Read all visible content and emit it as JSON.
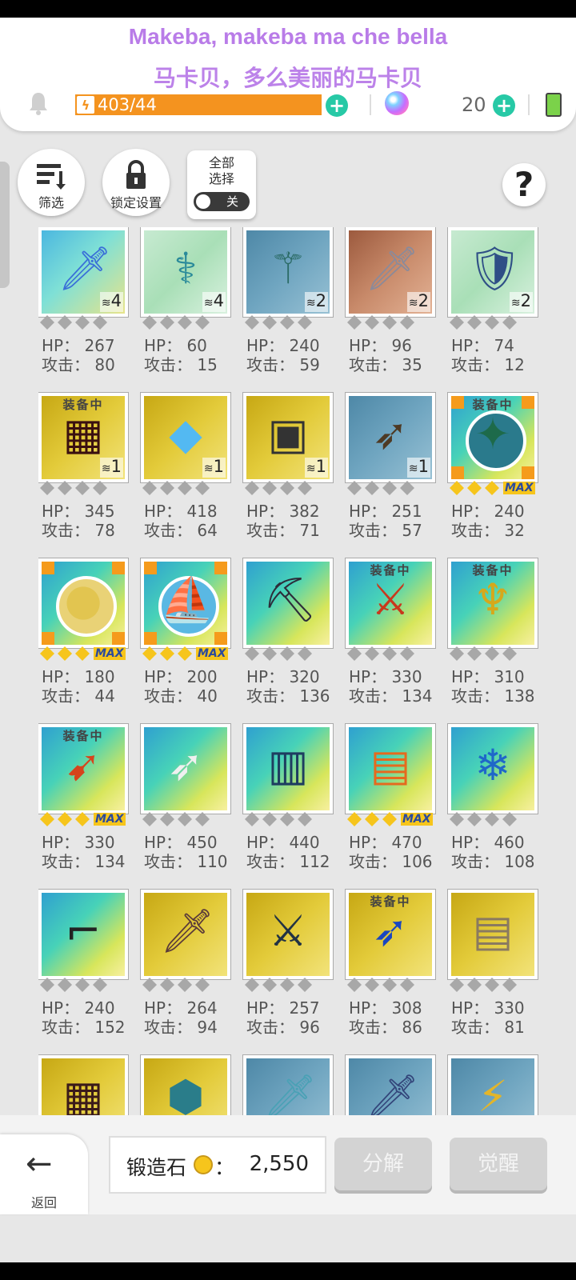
{
  "lyrics": {
    "line1": "Makeba, makeba ma che bella",
    "line2": "马卡贝，多么美丽的马卡贝"
  },
  "resources": {
    "energy": "403/44",
    "gems": "20",
    "bolt_icon": "lightning-icon"
  },
  "actions": {
    "filter_label": "筛选",
    "lock_label": "锁定设置",
    "select_all_label": "全部\n选择",
    "select_all_line1": "全部",
    "select_all_line2": "选择",
    "toggle_state": "关",
    "help_symbol": "?"
  },
  "equipped_label": "装备中",
  "items": [
    {
      "icon": "crystal-sword-icon",
      "bg": "blue",
      "qty": "4",
      "stars": 4,
      "gold": 0,
      "max": false,
      "equipped": false,
      "hp": "HP： 267",
      "atk": "攻击： 80"
    },
    {
      "icon": "staff-icon",
      "bg": "green",
      "qty": "4",
      "stars": 4,
      "gold": 0,
      "max": false,
      "equipped": false,
      "hp": "HP： 60",
      "atk": "攻击： 15"
    },
    {
      "icon": "scythe-staff-icon",
      "bg": "teal",
      "qty": "2",
      "stars": 4,
      "gold": 0,
      "max": false,
      "equipped": false,
      "hp": "HP： 240",
      "atk": "攻击： 59"
    },
    {
      "icon": "broadsword-icon",
      "bg": "copper",
      "qty": "2",
      "stars": 4,
      "gold": 0,
      "max": false,
      "equipped": false,
      "hp": "HP： 96",
      "atk": "攻击： 35"
    },
    {
      "icon": "shield-icon",
      "bg": "green",
      "qty": "2",
      "stars": 4,
      "gold": 0,
      "max": false,
      "equipped": false,
      "hp": "HP： 74",
      "atk": "攻击： 12"
    },
    {
      "icon": "dark-tome-icon",
      "bg": "gold",
      "qty": "1",
      "stars": 4,
      "gold": 0,
      "max": false,
      "equipped": true,
      "hp": "HP： 345",
      "atk": "攻击： 78"
    },
    {
      "icon": "diamond-icon",
      "bg": "gold",
      "qty": "1",
      "stars": 4,
      "gold": 0,
      "max": false,
      "equipped": false,
      "hp": "HP： 418",
      "atk": "攻击： 64"
    },
    {
      "icon": "device-icon",
      "bg": "gold",
      "qty": "1",
      "stars": 4,
      "gold": 0,
      "max": false,
      "equipped": false,
      "hp": "HP： 382",
      "atk": "攻击： 71"
    },
    {
      "icon": "bow-icon",
      "bg": "teal",
      "qty": "1",
      "stars": 4,
      "gold": 0,
      "max": false,
      "equipped": false,
      "hp": "HP： 251",
      "atk": "攻击： 57"
    },
    {
      "icon": "globe-orb-icon",
      "bg": "multi",
      "qty": "",
      "stars": 4,
      "gold": 3,
      "max": true,
      "equipped": true,
      "hp": "HP： 240",
      "atk": "攻击： 32",
      "orb": "#2a7a8c"
    },
    {
      "icon": "golden-orb-icon",
      "bg": "multi",
      "qty": "",
      "stars": 4,
      "gold": 3,
      "max": true,
      "equipped": false,
      "hp": "HP： 180",
      "atk": "攻击： 44",
      "orb": "#e9d276"
    },
    {
      "icon": "ship-orb-icon",
      "bg": "multi",
      "qty": "",
      "stars": 4,
      "gold": 3,
      "max": true,
      "equipped": false,
      "hp": "HP： 200",
      "atk": "攻击： 40",
      "orb": "#5ab8e3"
    },
    {
      "icon": "pickaxe-icon",
      "bg": "multi",
      "qty": "",
      "stars": 4,
      "gold": 0,
      "max": false,
      "equipped": false,
      "hp": "HP： 320",
      "atk": "攻击： 136"
    },
    {
      "icon": "flame-axe-icon",
      "bg": "multi",
      "qty": "",
      "stars": 4,
      "gold": 0,
      "max": false,
      "equipped": true,
      "hp": "HP： 330",
      "atk": "攻击： 134"
    },
    {
      "icon": "golden-trident-icon",
      "bg": "multi",
      "qty": "",
      "stars": 4,
      "gold": 0,
      "max": false,
      "equipped": true,
      "hp": "HP： 310",
      "atk": "攻击： 138"
    },
    {
      "icon": "fire-spear-icon",
      "bg": "multi",
      "qty": "",
      "stars": 4,
      "gold": 3,
      "max": true,
      "equipped": true,
      "hp": "HP： 330",
      "atk": "攻击： 134"
    },
    {
      "icon": "white-bow-icon",
      "bg": "multi",
      "qty": "",
      "stars": 4,
      "gold": 0,
      "max": false,
      "equipped": false,
      "hp": "HP： 450",
      "atk": "攻击： 110"
    },
    {
      "icon": "blue-tablet-icon",
      "bg": "multi",
      "qty": "",
      "stars": 4,
      "gold": 0,
      "max": false,
      "equipped": false,
      "hp": "HP： 440",
      "atk": "攻击： 112"
    },
    {
      "icon": "sun-book-icon",
      "bg": "multi",
      "qty": "",
      "stars": 4,
      "gold": 3,
      "max": true,
      "equipped": false,
      "hp": "HP： 470",
      "atk": "攻击： 106"
    },
    {
      "icon": "ice-staff-icon",
      "bg": "multi",
      "qty": "",
      "stars": 4,
      "gold": 0,
      "max": false,
      "equipped": false,
      "hp": "HP： 460",
      "atk": "攻击： 108"
    },
    {
      "icon": "rifle-icon",
      "bg": "multi",
      "qty": "",
      "stars": 4,
      "gold": 0,
      "max": false,
      "equipped": false,
      "hp": "HP： 240",
      "atk": "攻击： 152"
    },
    {
      "icon": "greatsword-icon",
      "bg": "gold",
      "qty": "",
      "stars": 4,
      "gold": 0,
      "max": false,
      "equipped": false,
      "hp": "HP： 264",
      "atk": "攻击： 94"
    },
    {
      "icon": "dark-blade-icon",
      "bg": "gold",
      "qty": "",
      "stars": 4,
      "gold": 0,
      "max": false,
      "equipped": false,
      "hp": "HP： 257",
      "atk": "攻击： 96"
    },
    {
      "icon": "blue-bow-icon",
      "bg": "gold",
      "qty": "",
      "stars": 4,
      "gold": 0,
      "max": false,
      "equipped": true,
      "hp": "HP： 308",
      "atk": "攻击： 86"
    },
    {
      "icon": "scroll-icon",
      "bg": "gold",
      "qty": "",
      "stars": 4,
      "gold": 0,
      "max": false,
      "equipped": false,
      "hp": "HP： 330",
      "atk": "攻击： 81"
    },
    {
      "icon": "runic-book-icon",
      "bg": "gold",
      "qty": "",
      "stars": 0,
      "gold": 0,
      "max": false,
      "equipped": false,
      "hp": "",
      "atk": ""
    },
    {
      "icon": "rune-shield-icon",
      "bg": "gold",
      "qty": "",
      "stars": 0,
      "gold": 0,
      "max": false,
      "equipped": false,
      "hp": "",
      "atk": ""
    },
    {
      "icon": "short-sword-icon",
      "bg": "teal",
      "qty": "",
      "stars": 0,
      "gold": 0,
      "max": false,
      "equipped": false,
      "hp": "",
      "atk": ""
    },
    {
      "icon": "dagger-icon",
      "bg": "teal",
      "qty": "",
      "stars": 0,
      "gold": 0,
      "max": false,
      "equipped": false,
      "hp": "",
      "atk": ""
    },
    {
      "icon": "golden-blade-icon",
      "bg": "teal",
      "qty": "",
      "stars": 0,
      "gold": 0,
      "max": false,
      "equipped": false,
      "hp": "",
      "atk": ""
    }
  ],
  "bottom": {
    "back_label": "返回",
    "stone_label": "锻造石",
    "stone_colon": "：",
    "stone_value": "2,550",
    "disassemble_label": "分解",
    "awaken_label": "觉醒"
  }
}
